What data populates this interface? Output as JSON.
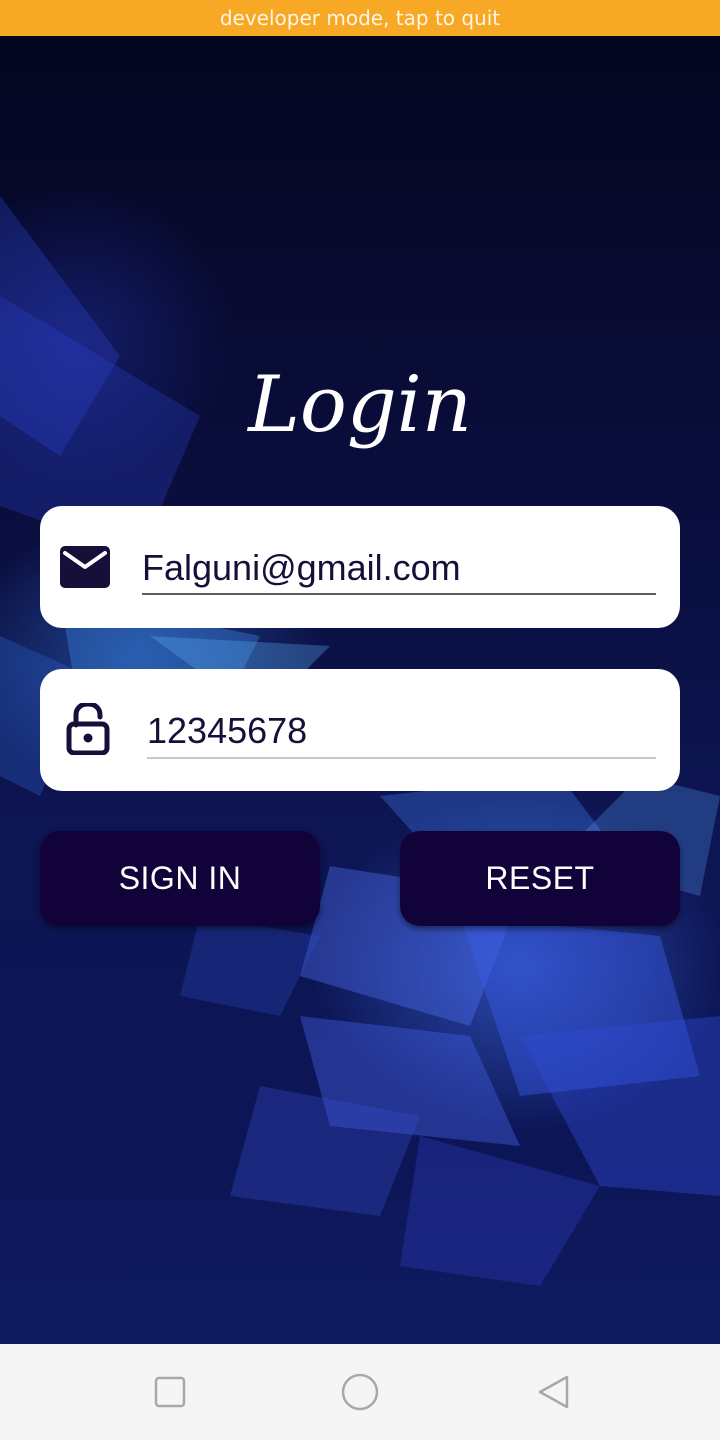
{
  "status_banner": {
    "text": "developer mode, tap to quit"
  },
  "login": {
    "title": "Login",
    "email": {
      "value": "Falguni@gmail.com",
      "icon": "mail-icon"
    },
    "password": {
      "value": "12345678",
      "icon": "lock-open-icon"
    },
    "buttons": {
      "sign_in": "SIGN IN",
      "reset": "RESET"
    }
  },
  "colors": {
    "banner": "#f7a824",
    "button_bg": "#12023a",
    "field_bg": "#ffffff",
    "text_dark": "#14103a",
    "background_dark": "#07082b",
    "background_accent": "#3d6ef0"
  },
  "navigation_bar": {
    "items": [
      {
        "icon": "recents-square-icon"
      },
      {
        "icon": "home-circle-icon"
      },
      {
        "icon": "back-triangle-icon"
      }
    ]
  }
}
